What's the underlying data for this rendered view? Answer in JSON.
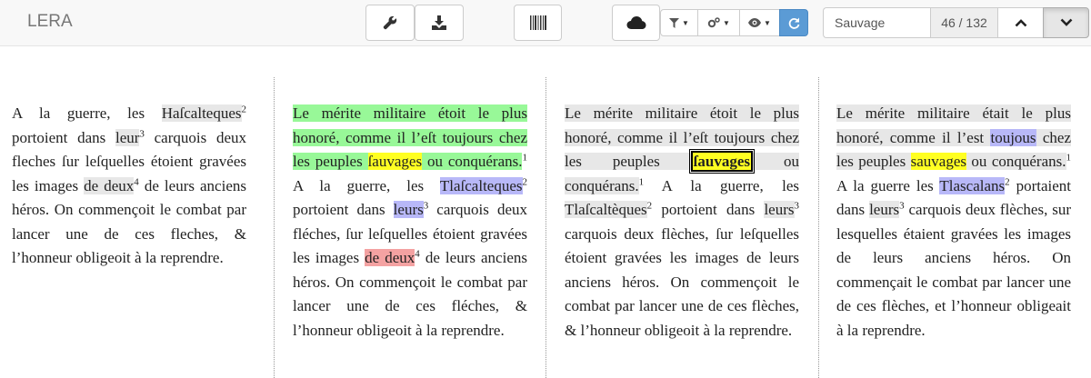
{
  "app": {
    "brand": "LERA"
  },
  "toolbar": {
    "icons": [
      "wrench-icon",
      "download-icon",
      "barcode-icon",
      "cloud-icon",
      "filter-icon",
      "cogs-icon",
      "eye-icon",
      "refresh-icon"
    ],
    "search": {
      "value": "Sauvage",
      "count": "46 / 132"
    }
  },
  "colors": {
    "gray": "#e7e7e7",
    "green": "#98f898",
    "yellow": "#ffff22",
    "blue": "#b8b8f8",
    "red": "#f4a2a2",
    "active_button": "#5b9bd5"
  },
  "columns": [
    {
      "segments": [
        {
          "text": "A la guerre, les ",
          "hl": ""
        },
        {
          "text": "Haſcalteques",
          "hl": "gray"
        },
        {
          "text": "2",
          "sup": true
        },
        {
          "text": " portoient dans ",
          "hl": ""
        },
        {
          "text": "leur",
          "hl": "gray"
        },
        {
          "text": "3",
          "sup": true
        },
        {
          "text": " carquois deux fleches ſur leſquelles étoient gravées les images ",
          "hl": ""
        },
        {
          "text": "de deux",
          "hl": "gray"
        },
        {
          "text": "4",
          "sup": true
        },
        {
          "text": " de leurs anciens héros. On commençoit le combat par lancer une de ces fleches, & l’honneur obligeoit à la reprendre.",
          "hl": ""
        }
      ]
    },
    {
      "segments": [
        {
          "text": "Le mérite militaire étoit le plus honoré, comme il l’eſt toujours chez les peuples ",
          "hl": "green"
        },
        {
          "text": "ſauvages",
          "hl": "yellow"
        },
        {
          "text": " ou conquérans.",
          "hl": "green"
        },
        {
          "text": "1",
          "sup": true
        },
        {
          "text": " A la guerre, les ",
          "hl": ""
        },
        {
          "text": "Tlaſcalteques",
          "hl": "blue"
        },
        {
          "text": "2",
          "sup": true
        },
        {
          "text": " portoient dans ",
          "hl": ""
        },
        {
          "text": "leurs",
          "hl": "blue"
        },
        {
          "text": "3",
          "sup": true
        },
        {
          "text": " carquois deux fléches, ſur leſquelles étoient gravées les images ",
          "hl": ""
        },
        {
          "text": "de deux",
          "hl": "red"
        },
        {
          "text": "4",
          "sup": true
        },
        {
          "text": " de leurs anciens héros. On commençoit le combat par lancer une de ces fléches, & l’honneur obligeoit à la reprendre.",
          "hl": ""
        }
      ]
    },
    {
      "segments": [
        {
          "text": "Le mérite militaire étoit le plus honoré, comme il l’eſt toujours chez les peuples ",
          "hl": "gray"
        },
        {
          "text": "ſauvages",
          "hl": "current"
        },
        {
          "text": " ou conquérans.",
          "hl": "gray"
        },
        {
          "text": "1",
          "sup": true
        },
        {
          "text": " A la guerre, les ",
          "hl": ""
        },
        {
          "text": "Tlaſcaltèques",
          "hl": "gray"
        },
        {
          "text": "2",
          "sup": true
        },
        {
          "text": " portoient dans ",
          "hl": ""
        },
        {
          "text": "leurs",
          "hl": "gray"
        },
        {
          "text": "3",
          "sup": true
        },
        {
          "text": " carquois deux flèches, ſur leſquelles étoient gravées les images de leurs anciens héros. On commençoit le combat par lancer une de ces flèches, & l’honneur obligeoit à la reprendre.",
          "hl": ""
        }
      ]
    },
    {
      "segments": [
        {
          "text": "Le mérite militaire était le plus honoré, comme il l’est ",
          "hl": "gray"
        },
        {
          "text": "toujous",
          "hl": "blue"
        },
        {
          "text": " chez les peuples ",
          "hl": "gray"
        },
        {
          "text": "sauvages",
          "hl": "yellow"
        },
        {
          "text": " ou conquérans.",
          "hl": "gray"
        },
        {
          "text": "1",
          "sup": true
        },
        {
          "text": " A la guerre les ",
          "hl": ""
        },
        {
          "text": "Tlascalans",
          "hl": "blue"
        },
        {
          "text": "2",
          "sup": true
        },
        {
          "text": " portaient dans ",
          "hl": ""
        },
        {
          "text": "leurs",
          "hl": "gray"
        },
        {
          "text": "3",
          "sup": true
        },
        {
          "text": " carquois deux flèches, sur lesquelles étaient gravées les images de leurs anciens héros. On commençait le combat par lancer une de ces flèches, et l’honneur obligeait à la reprendre.",
          "hl": ""
        }
      ]
    }
  ]
}
